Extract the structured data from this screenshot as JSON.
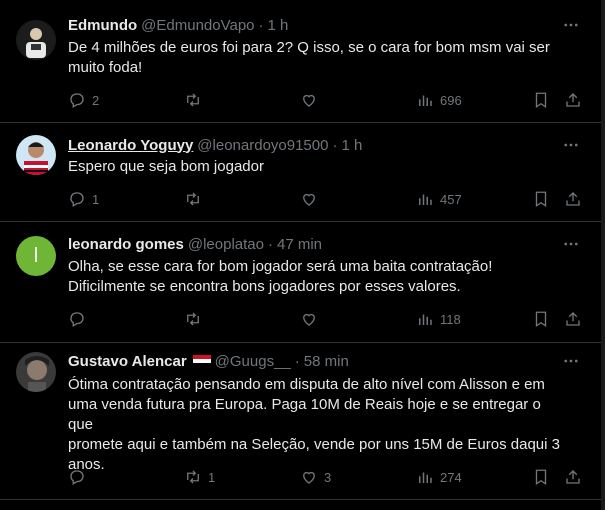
{
  "colors": {
    "background": "#000000",
    "text": "#e7e9ea",
    "muted": "#71767b",
    "divider": "#2f3336"
  },
  "tweets": [
    {
      "name": "Edmundo",
      "handle": "@EdmundoVapo",
      "separator": "·",
      "time": "1 h",
      "text_lines": [
        "De 4 milhões de euros foi para 2? Q isso, se o cara for bom msm vai ser",
        "muito foda!"
      ],
      "replies": "2",
      "retweets": "",
      "likes": "",
      "views": "696"
    },
    {
      "name": "Leonardo Yoguyy",
      "handle": "@leonardoyo91500",
      "separator": "·",
      "time": "1 h",
      "text_lines": [
        "Espero que seja bom jogador"
      ],
      "replies": "1",
      "retweets": "",
      "likes": "",
      "views": "457"
    },
    {
      "name": "leonardo gomes",
      "handle": "@leoplatao",
      "separator": "·",
      "time": "47 min",
      "avatar_letter": "l",
      "text_lines": [
        "Olha, se esse cara for bom jogador será uma baita contratação!",
        "Dificilmente se encontra bons jogadores por esses valores."
      ],
      "replies": "",
      "retweets": "",
      "likes": "",
      "views": "118"
    },
    {
      "name": "Gustavo Alencar",
      "handle": "@Guugs__",
      "separator": "·",
      "time": "58 min",
      "text_lines": [
        "Ótima contratação pensando em disputa de alto nível com Alisson e em",
        "uma venda futura pra Europa. Paga 10M de Reais hoje e se entregar o que",
        "promete aqui e também na Seleção, vende por uns 15M de Euros daqui 3",
        "anos."
      ],
      "replies": "",
      "retweets": "1",
      "likes": "3",
      "views": "274"
    }
  ],
  "icons": {
    "more": "more-dots-icon",
    "reply": "reply-icon",
    "retweet": "retweet-icon",
    "like": "like-icon",
    "views": "views-icon",
    "bookmark": "bookmark-icon",
    "share": "share-icon"
  }
}
